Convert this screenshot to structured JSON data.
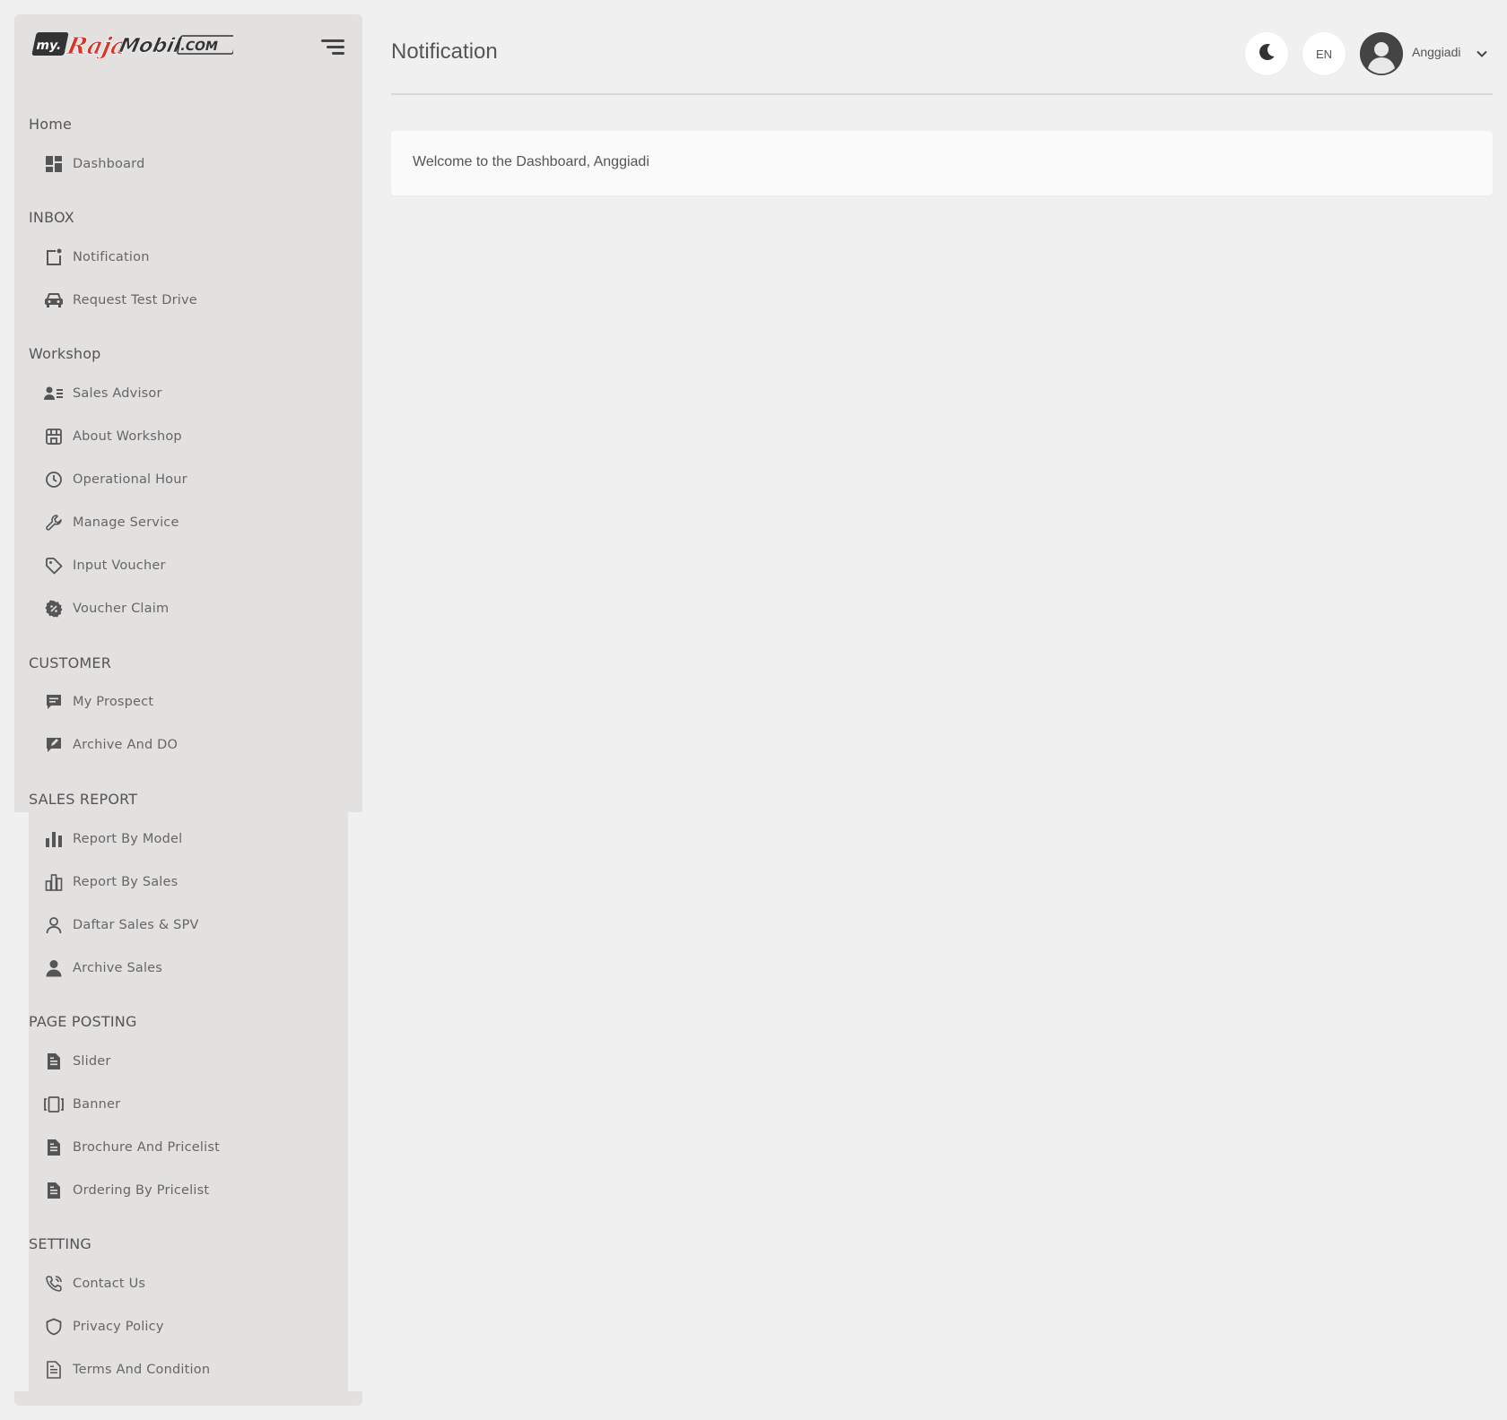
{
  "brand": {
    "logo_text": "my.RajaMobil.COM"
  },
  "header": {
    "title": "Notification",
    "language": "EN",
    "user_name": "Anggiadi"
  },
  "main": {
    "welcome_text": "Welcome to the Dashboard, Anggiadi"
  },
  "sidebar": {
    "sections": [
      {
        "title": "Home",
        "items": [
          {
            "label": "Dashboard",
            "icon": "dashboard-icon"
          }
        ]
      },
      {
        "title": "INBOX",
        "items": [
          {
            "label": "Notification",
            "icon": "notification-icon"
          },
          {
            "label": "Request Test Drive",
            "icon": "car-icon"
          }
        ]
      },
      {
        "title": "Workshop",
        "items": [
          {
            "label": "Sales Advisor",
            "icon": "user-list-icon"
          },
          {
            "label": "About Workshop",
            "icon": "store-icon"
          },
          {
            "label": "Operational Hour",
            "icon": "clock-icon"
          },
          {
            "label": "Manage Service",
            "icon": "wrench-icon"
          },
          {
            "label": "Input Voucher",
            "icon": "tag-icon"
          },
          {
            "label": "Voucher Claim",
            "icon": "discount-badge-icon"
          }
        ]
      },
      {
        "title": "CUSTOMER",
        "items": [
          {
            "label": "My Prospect",
            "icon": "message-icon"
          },
          {
            "label": "Archive And DO",
            "icon": "edit-note-icon"
          }
        ]
      },
      {
        "title": "SALES REPORT",
        "items": [
          {
            "label": "Report By Model",
            "icon": "bar-chart-icon"
          },
          {
            "label": "Report By Sales",
            "icon": "bar-chart-outline-icon"
          },
          {
            "label": "Daftar Sales & SPV",
            "icon": "user-outline-icon"
          },
          {
            "label": "Archive Sales",
            "icon": "user-filled-icon"
          }
        ]
      },
      {
        "title": "PAGE POSTING",
        "items": [
          {
            "label": "Slider",
            "icon": "document-icon"
          },
          {
            "label": "Banner",
            "icon": "carousel-icon"
          },
          {
            "label": "Brochure And Pricelist",
            "icon": "document-icon"
          },
          {
            "label": "Ordering By Pricelist",
            "icon": "document-icon"
          }
        ]
      },
      {
        "title": "SETTING",
        "items": [
          {
            "label": "Contact Us",
            "icon": "phone-icon"
          },
          {
            "label": "Privacy Policy",
            "icon": "shield-icon"
          },
          {
            "label": "Terms And Condition",
            "icon": "document-outline-icon"
          }
        ]
      }
    ]
  },
  "colors": {
    "page_bg": "#f0f0f0",
    "sidebar_bg": "#e2e1e0",
    "text": "#555555",
    "logo_red": "#d9342b",
    "logo_dark": "#333333"
  }
}
